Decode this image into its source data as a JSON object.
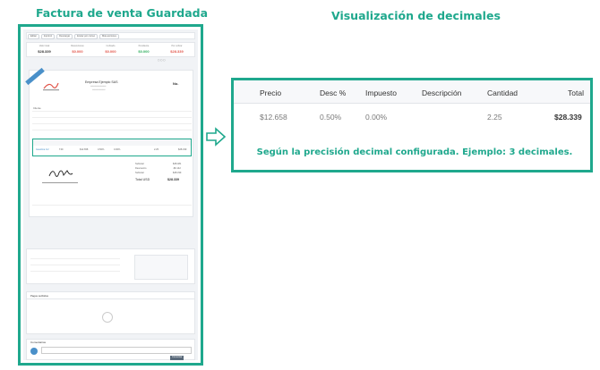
{
  "headings": {
    "left": "Factura de venta Guardada",
    "right": "Visualización de decimales"
  },
  "colors": {
    "accent": "#1fa88d",
    "red": "#e2574c",
    "green": "#2fae5e",
    "blue": "#4a90c9"
  },
  "invoice_preview": {
    "toolbar": [
      "Editar",
      "Imprimir",
      "Descargar",
      "Enviar por correo",
      "Más acciones"
    ],
    "summary": [
      {
        "label": "Valor total",
        "value": "$28.339",
        "color": "#333333"
      },
      {
        "label": "Retenciones",
        "value": "$0.000",
        "color": "#e2574c"
      },
      {
        "label": "Cobrado",
        "value": "$0.000",
        "color": "#e2574c"
      },
      {
        "label": "Pendiente",
        "value": "$0.000",
        "color": "#2fae5e"
      },
      {
        "label": "Por cobrar",
        "value": "$28.339",
        "color": "#e2574c"
      }
    ],
    "company": "Empresa Ejemplo SAS",
    "number": "No.",
    "client_label": "Cliente",
    "items_headers": [
      "Ítem",
      "Referencia",
      "Precio",
      "Desc %",
      "Impuesto",
      "Descripción",
      "Cantidad",
      "Total"
    ],
    "item_row": [
      "Gasolina 1/2",
      "T49",
      "$12.658",
      "0.50%",
      "0.00%",
      "",
      "2.25",
      "$28.339"
    ],
    "totals": [
      {
        "label": "Subtotal",
        "value": "$28.481"
      },
      {
        "label": "Descuento",
        "value": "-$0.142"
      },
      {
        "label": "Subtotal",
        "value": "$28.339"
      }
    ],
    "total_label": "Total USD",
    "total_value": "$28.339",
    "sections": [
      "Pagos recibidos",
      "Comentarios"
    ],
    "comment_button": "Comentar"
  },
  "detail": {
    "headers": [
      "Precio",
      "Desc %",
      "Impuesto",
      "Descripción",
      "Cantidad",
      "Total"
    ],
    "values": [
      "$12.658",
      "0.50%",
      "0.00%",
      "",
      "2.25",
      "$28.339"
    ],
    "note": "Según la precisión decimal configurada. Ejemplo: 3 decimales."
  }
}
